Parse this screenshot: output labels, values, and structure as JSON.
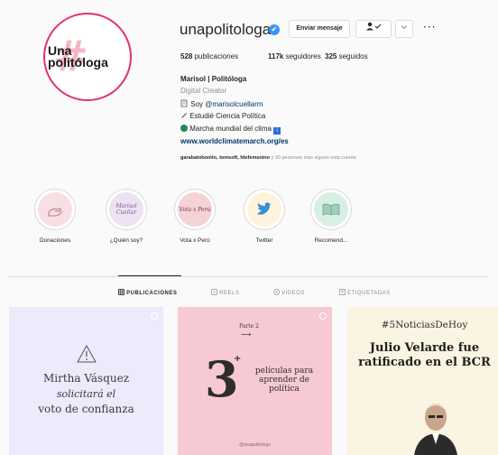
{
  "profile": {
    "username": "unapolitologa",
    "avatar_text": "Una politóloga",
    "avatar_hash": "#",
    "message_button": "Enviar mensaje",
    "follow_icon": "person-check-icon",
    "dropdown_icon": "chevron-down-icon",
    "more_icon": "more-dots-icon",
    "more_glyph": "···",
    "verified_glyph": "✔"
  },
  "stats": {
    "posts_num": "528",
    "posts_label": "publicaciones",
    "followers_num": "117k",
    "followers_label": "seguidores",
    "following_num": "325",
    "following_label": "seguidos"
  },
  "bio": {
    "name": "Marisol | Politóloga",
    "category": "Digital Creator",
    "line1_prefix": "Soy",
    "line1_mention": "@marisolcuellarm",
    "line2": "Estudié Ciencia Política",
    "line3": "Marcha mundial del clima",
    "link": "www.worldclimatemarch.org/es",
    "followed_by_names": "garabatobonito, tomsoft, fdefemenino",
    "followed_by_rest": "y 30 personas más siguen esta cuenta"
  },
  "highlights": [
    {
      "label": "Donaciones",
      "cover_text": ""
    },
    {
      "label": "¿Quién soy?",
      "cover_text": "Marisol Cuellar"
    },
    {
      "label": "Vota x Perú",
      "cover_text": "Vota x Perú"
    },
    {
      "label": "Twitter",
      "cover_text": ""
    },
    {
      "label": "Recomend...",
      "cover_text": ""
    }
  ],
  "tabs": [
    {
      "label": "PUBLICACIONES",
      "active": true
    },
    {
      "label": "REELS",
      "active": false
    },
    {
      "label": "VIDEOS",
      "active": false
    },
    {
      "label": "ETIQUETADAS",
      "active": false
    }
  ],
  "posts": {
    "p1": {
      "title": "Mirtha Vásquez",
      "italic": "solicitará el",
      "bottom": "voto de confianza"
    },
    "p2": {
      "parte": "Parte 2",
      "number": "3",
      "plus": "+",
      "text": "películas para aprender de política",
      "footer": "@unapolitologa"
    },
    "p3": {
      "tag": "#5NoticiasDeHoy",
      "title": "Julio Velarde fue ratificado en el BCR"
    }
  },
  "colors": {
    "accent_ring": "#e3326a",
    "link": "#00376b",
    "verified": "#3897f0"
  }
}
